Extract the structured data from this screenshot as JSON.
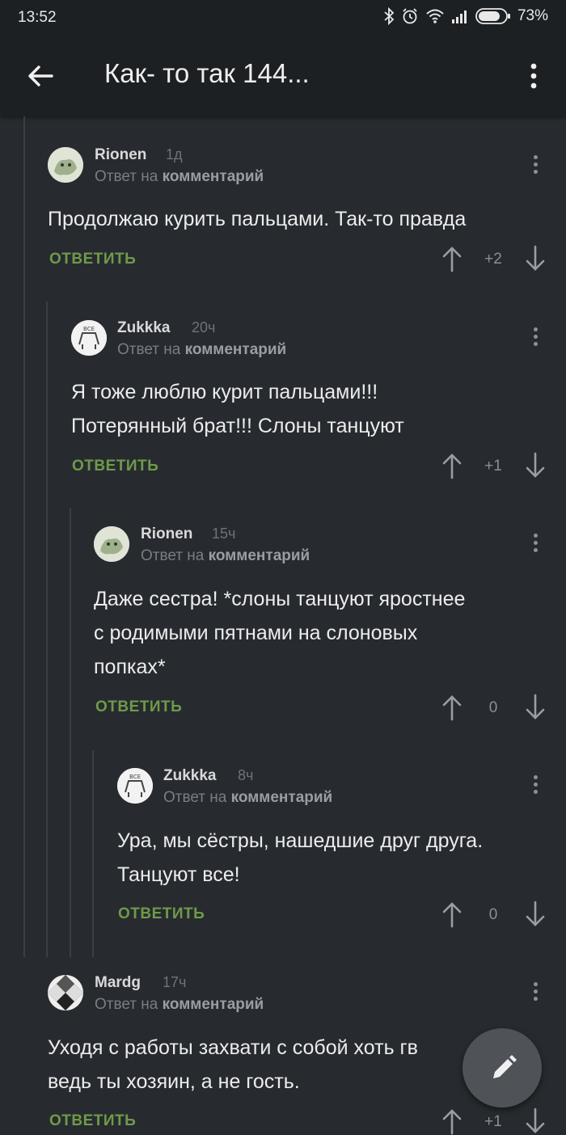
{
  "status_bar": {
    "time": "13:52",
    "battery": "73%",
    "icons": [
      "bluetooth-icon",
      "alarm-icon",
      "wifi-icon",
      "signal-icon",
      "battery-icon"
    ]
  },
  "app_bar": {
    "title": "Как- то так 144...",
    "back_icon": "arrow-left-icon",
    "menu_icon": "more-vert-icon"
  },
  "reply_label": "ОТВЕТИТЬ",
  "reply_prefix": "Ответ на",
  "reply_target": "комментарий",
  "comments": [
    {
      "author": "Rionen",
      "time": "1д",
      "text_lines": [
        "Продолжаю курить пальцами. Так-то правда"
      ],
      "score": "+2"
    },
    {
      "author": "Zukkka",
      "time": "20ч",
      "text_lines": [
        "Я тоже люблю курит пальцами!!!",
        "Потерянный брат!!! Слоны танцуют"
      ],
      "score": "+1"
    },
    {
      "author": "Rionen",
      "time": "15ч",
      "text_lines": [
        "Даже сестра! *слоны танцуют яростнее",
        "с родимыми пятнами на слоновых",
        "попках*"
      ],
      "score": "0"
    },
    {
      "author": "Zukkka",
      "time": "8ч",
      "text_lines": [
        "Ура, мы сёстры, нашедшие друг друга.",
        "Танцуют все!"
      ],
      "score": "0"
    },
    {
      "author": "Mardg",
      "time": "17ч",
      "text_lines": [
        "Уходя с работы захвати с собой хоть гв",
        "ведь ты хозяин, а не гость."
      ],
      "score": "+1"
    }
  ],
  "fab_icon": "pencil-icon",
  "colors": {
    "background": "#272b2f",
    "toolbar": "#1d2023",
    "reply_green": "#6f9a4a",
    "muted_text": "#7a7e83"
  }
}
